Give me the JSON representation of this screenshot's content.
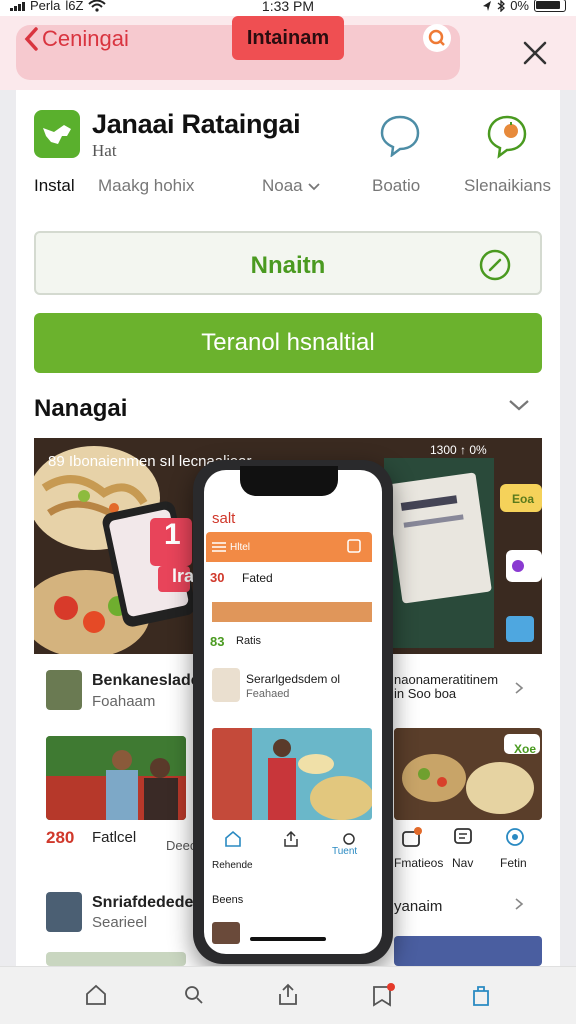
{
  "status_bar": {
    "carrier": "Perla",
    "network": "l6Z",
    "time": "1:33 PM",
    "battery": "0%"
  },
  "nav": {
    "back_label": "Ceningai",
    "tab_chip": "Intainam"
  },
  "app": {
    "title": "Janaai Rataingai",
    "subtitle": "Hat"
  },
  "tabs": [
    "Instal",
    "Maakg hohix",
    "Noaa",
    "Boatio",
    "Slenaikians"
  ],
  "buttons": {
    "outline": "Nnaitn",
    "primary": "Teranol hsnaltial"
  },
  "section": {
    "title": "Nanagai"
  },
  "hero": {
    "text": "89 Ibonaienmen sıl lecnaalioar",
    "status": "1300 ↑ 0% ",
    "badge_number": "1",
    "badge_suffix": "lra",
    "tag_right": "Eoa"
  },
  "phone": {
    "title": "salt",
    "bar_label": "Hltel",
    "row1_num": "30",
    "row1_label": "Fated",
    "row2_num": "83",
    "row2_label": "Ratis",
    "item_title": "Serarlgedsdem ol",
    "item_sub": "Feahaed",
    "nav_items": [
      "Rehende",
      "",
      "Tuent"
    ],
    "bottom_label": "Beens"
  },
  "list": {
    "item1_title": "Benkaneslade",
    "item1_sub": "Foahaam",
    "item1_right": "naonameratitinem",
    "item1_right2": "in Soo boa",
    "item2_num": "280",
    "item2_label": "Fatlcel",
    "item2_mid": "Deec",
    "item2_right": [
      "Fmatieos",
      "Nav",
      "Fetin"
    ],
    "item2_tag": "Xoe",
    "item3_title": "Snriafdedede",
    "item3_sub": "Searieel",
    "item3_right": "yanaim"
  },
  "colors": {
    "accent_green": "#6bb22d",
    "accent_red": "#ef4f52",
    "orange": "#f28a45"
  }
}
